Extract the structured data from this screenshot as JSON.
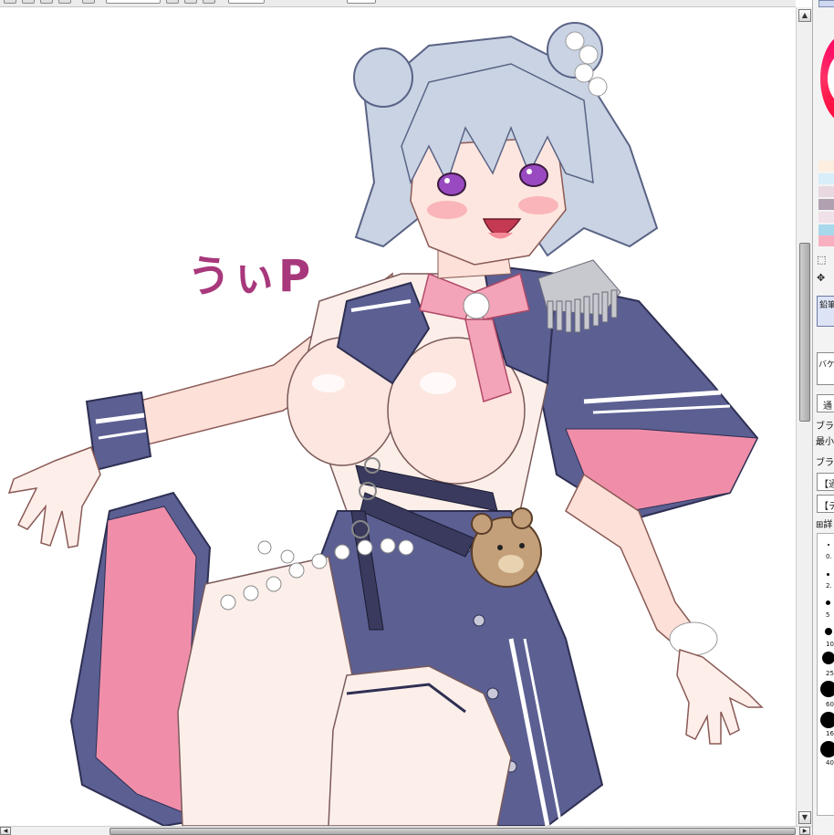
{
  "canvas": {
    "text_signature": "うぃP",
    "signature_color": "#a8387c"
  },
  "colors": {
    "hair": "#c9d3e3",
    "hair_shadow": "#8e9ab8",
    "coat": "#5b5f92",
    "coat_lining": "#f08eaa",
    "bow": "#f4a4b8",
    "skin": "#fde0d8",
    "shirt": "#fcefea"
  },
  "scrollbars": {
    "up_arrow": "▲",
    "down_arrow": "▼",
    "left_arrow": "◀",
    "right_arrow": "▶"
  },
  "panel": {
    "tool_label_1": "鉛筆",
    "bucket_label": "バケ",
    "blend_mode": "通",
    "brush_shape_label": "ブラシ",
    "min_size_label": "最小",
    "brush_texture_label": "ブラシ",
    "mode_1": "【通",
    "mode_2": "【テ",
    "detail_label": "詳",
    "brush_sizes": [
      "0.",
      "2.",
      "5",
      "10",
      "25",
      "60",
      "16",
      "40"
    ]
  }
}
